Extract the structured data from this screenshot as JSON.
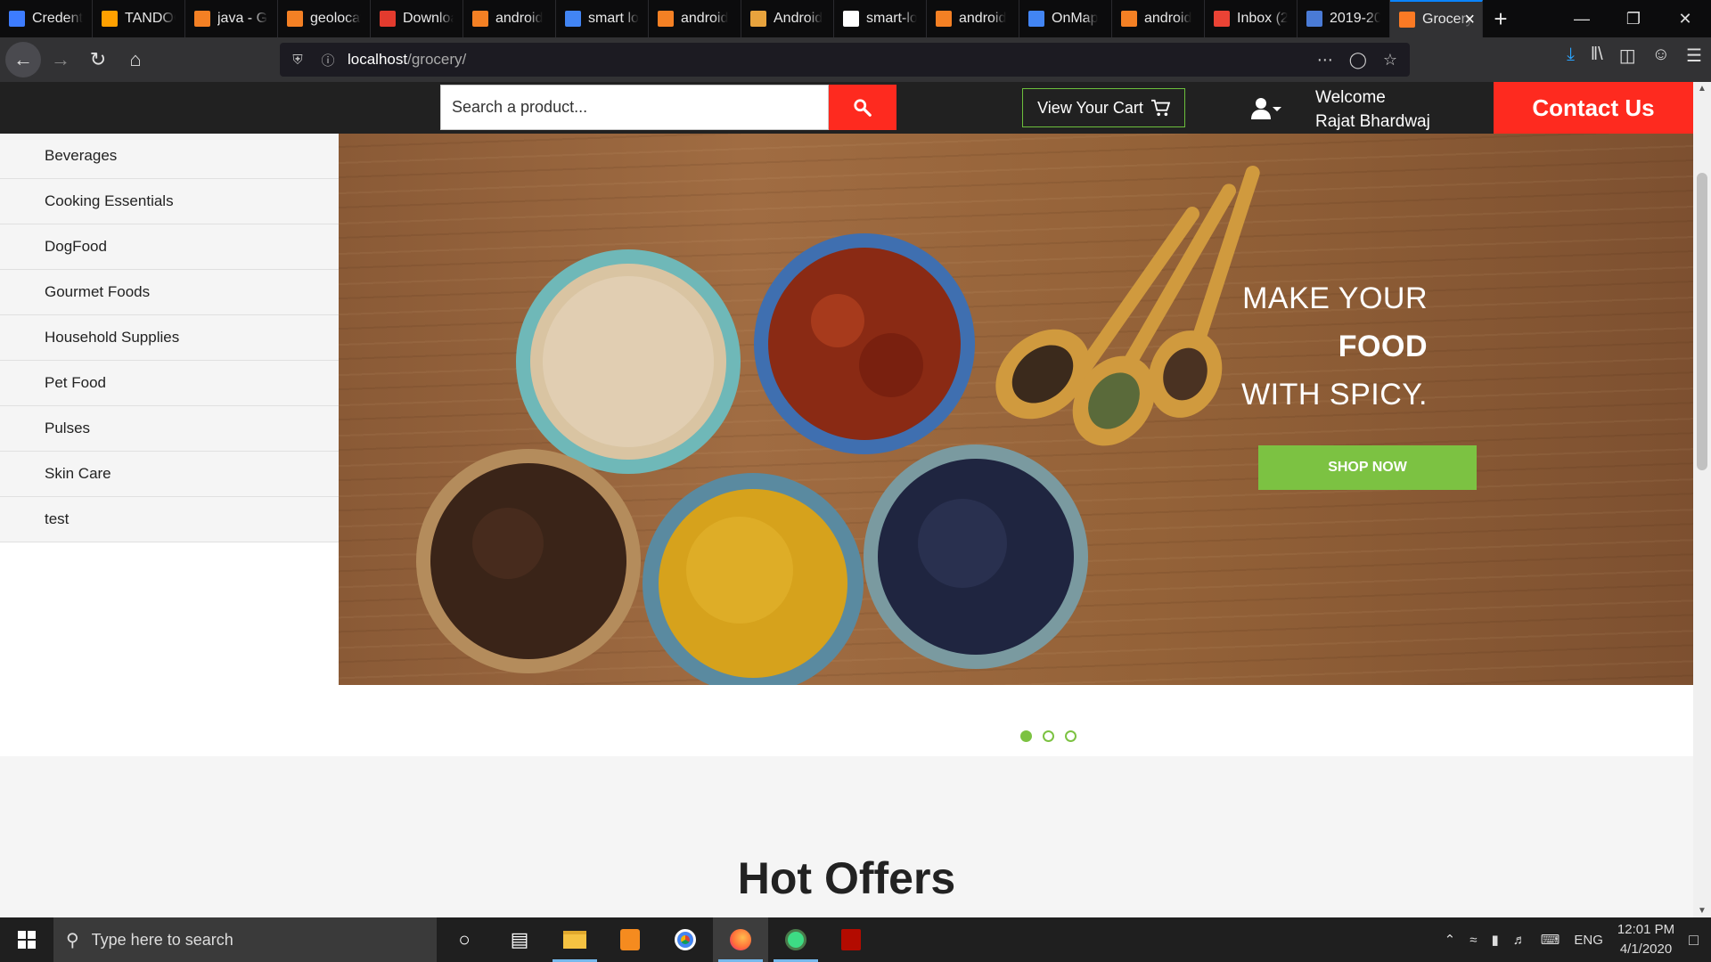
{
  "browser": {
    "tabs": [
      {
        "label": "Credentials",
        "icon": "api-icon",
        "color": "#3d7cff"
      },
      {
        "label": "TANDOOR",
        "icon": "firebase-icon",
        "color": "#ffa000"
      },
      {
        "label": "java - Go",
        "icon": "stackoverflow-icon",
        "color": "#f48024"
      },
      {
        "label": "geolocation",
        "icon": "stackoverflow-icon",
        "color": "#f48024"
      },
      {
        "label": "Download",
        "icon": "g-icon",
        "color": "#e33b2e"
      },
      {
        "label": "android",
        "icon": "stackoverflow-icon",
        "color": "#f48024"
      },
      {
        "label": "smart lo",
        "icon": "google-icon",
        "color": "#4285f4"
      },
      {
        "label": "android",
        "icon": "stackoverflow-icon",
        "color": "#f48024"
      },
      {
        "label": "Android",
        "icon": "j-icon",
        "color": "#e8a33d"
      },
      {
        "label": "smart-lo",
        "icon": "github-icon",
        "color": "#ffffff"
      },
      {
        "label": "android",
        "icon": "stackoverflow-icon",
        "color": "#f48024"
      },
      {
        "label": "OnMap",
        "icon": "onmap-icon",
        "color": "#4285f4"
      },
      {
        "label": "android",
        "icon": "stackoverflow-icon",
        "color": "#f48024"
      },
      {
        "label": "Inbox (2",
        "icon": "gmail-icon",
        "color": "#ea4335"
      },
      {
        "label": "2019-20",
        "icon": "contacts-icon",
        "color": "#4a7bd6"
      },
      {
        "label": "Grocery",
        "icon": "xampp-icon",
        "color": "#fb7a24"
      }
    ],
    "url_host": "localhost",
    "url_path": "/grocery/"
  },
  "header": {
    "search_placeholder": "Search a product...",
    "cart_label": "View Your Cart",
    "welcome": "Welcome",
    "user_name": "Rajat Bhardwaj",
    "contact_label": "Contact Us"
  },
  "sidebar": {
    "items": [
      {
        "label": "Beverages"
      },
      {
        "label": "Cooking Essentials"
      },
      {
        "label": "DogFood"
      },
      {
        "label": "Gourmet Foods"
      },
      {
        "label": "Household Supplies"
      },
      {
        "label": "Pet Food"
      },
      {
        "label": "Pulses"
      },
      {
        "label": "Skin Care"
      },
      {
        "label": "test"
      }
    ]
  },
  "hero": {
    "line1": "MAKE YOUR",
    "line2": "FOOD",
    "line3": "WITH SPICY.",
    "cta": "SHOP NOW",
    "active_slide": 1,
    "slide_count": 3
  },
  "section_title": "Hot Offers",
  "taskbar": {
    "search_placeholder": "Type here to search",
    "language": "ENG",
    "time": "12:01 PM",
    "date": "4/1/2020"
  },
  "colors": {
    "accent_red": "#fe2a1f",
    "accent_green": "#7cc242",
    "header_dark": "#212121"
  }
}
